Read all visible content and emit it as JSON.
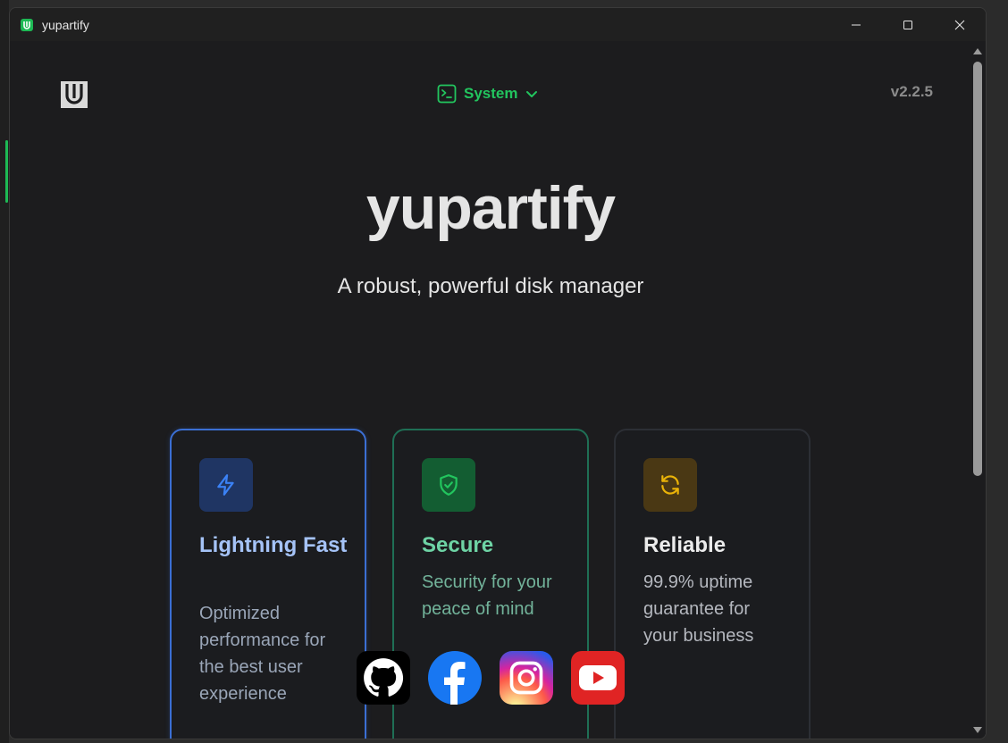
{
  "window": {
    "title": "yupartify"
  },
  "header": {
    "platform_selector": "System",
    "version": "v2.2.5"
  },
  "hero": {
    "title": "yupartify",
    "subtitle": "A robust, powerful disk manager"
  },
  "features": [
    {
      "title": "Lightning Fast",
      "description": "Optimized performance for the best user experience",
      "icon": "lightning-icon",
      "accent": "#3b6fd4"
    },
    {
      "title": "Secure",
      "description": "Security for your peace of mind",
      "icon": "shield-check-icon",
      "accent": "#22c55e"
    },
    {
      "title": "Reliable",
      "description": "99.9% uptime guarantee for your business",
      "icon": "refresh-icon",
      "accent": "#eab308"
    }
  ],
  "socials": [
    {
      "name": "github",
      "icon": "github-icon"
    },
    {
      "name": "facebook",
      "icon": "facebook-icon"
    },
    {
      "name": "instagram",
      "icon": "instagram-icon"
    },
    {
      "name": "youtube",
      "icon": "youtube-icon"
    }
  ],
  "colors": {
    "accent_green": "#22c55e",
    "background": "#1c1c1e",
    "title_text": "#e5e5e5"
  }
}
